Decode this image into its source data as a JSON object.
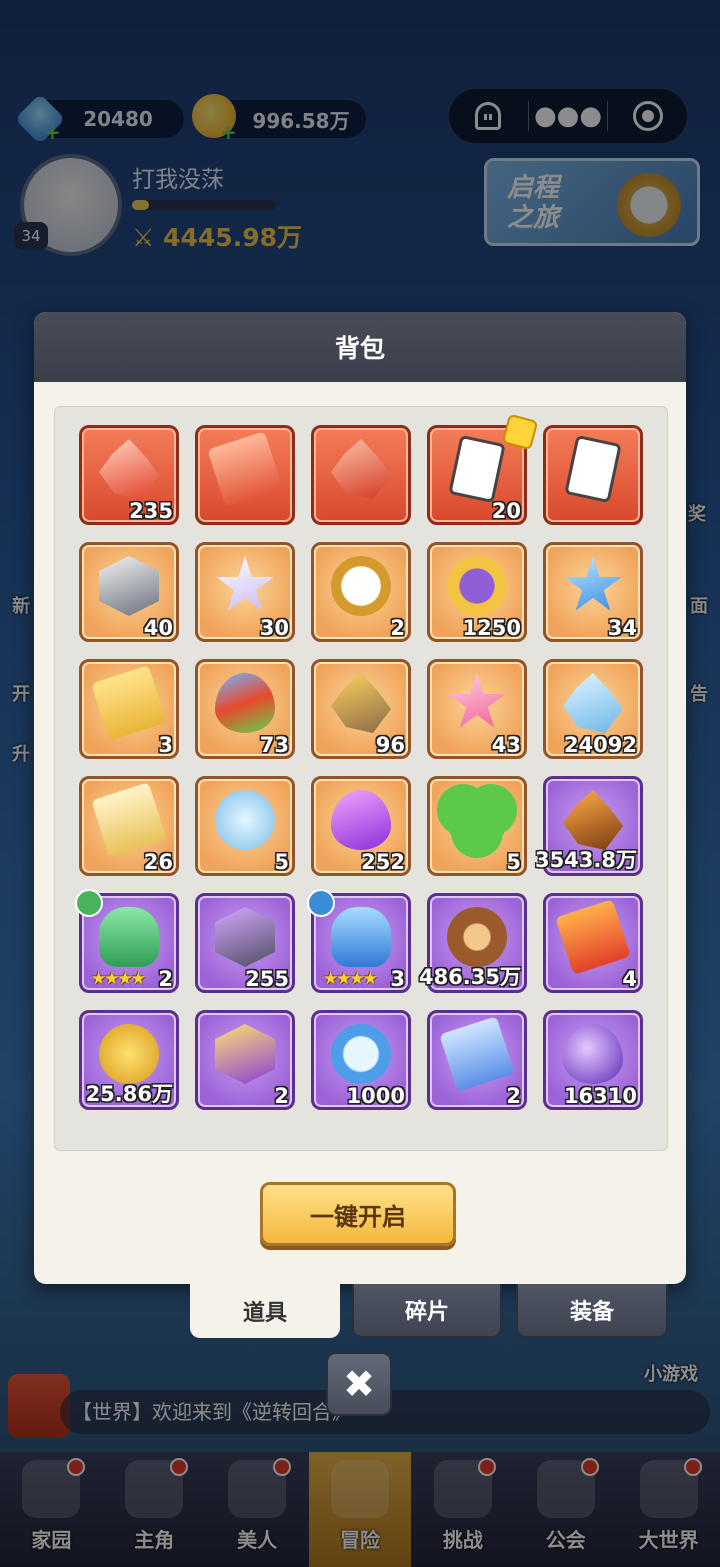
{
  "resources": {
    "gems": "20480",
    "coins": "996.58万"
  },
  "player": {
    "name": "打我没莯",
    "level": "34",
    "power": "4445.98万"
  },
  "journey_banner": {
    "line1": "启程",
    "line2": "之旅"
  },
  "side_texts": {
    "reward": "奖",
    "new": "新",
    "open": "开",
    "notice": "告",
    "face": "面",
    "upgrade": "升"
  },
  "chat": {
    "text": "【世界】欢迎来到《逆转回合》"
  },
  "mini_game": "小游戏",
  "modal": {
    "title": "背包",
    "confirm_label": "一键开启",
    "items": [
      {
        "count": "235",
        "rarity": "red",
        "icon": "red-crystal-icon"
      },
      {
        "count": "",
        "rarity": "red",
        "icon": "m-ticket-icon"
      },
      {
        "count": "",
        "rarity": "red",
        "icon": "crystal-chest-icon"
      },
      {
        "count": "20",
        "rarity": "red",
        "icon": "card-fragment-icon"
      },
      {
        "count": "",
        "rarity": "red",
        "icon": "card-icon"
      },
      {
        "count": "40",
        "rarity": "orange",
        "icon": "chest-cube-icon"
      },
      {
        "count": "30",
        "rarity": "orange",
        "icon": "star-icon"
      },
      {
        "count": "2",
        "rarity": "orange",
        "icon": "pocket-watch-icon"
      },
      {
        "count": "1250",
        "rarity": "orange",
        "icon": "compass-coin-icon"
      },
      {
        "count": "34",
        "rarity": "orange",
        "icon": "blue-star-icon"
      },
      {
        "count": "3",
        "rarity": "orange",
        "icon": "summon-ticket-icon"
      },
      {
        "count": "73",
        "rarity": "orange",
        "icon": "flame-orb-icon"
      },
      {
        "count": "96",
        "rarity": "orange",
        "icon": "gold-ore-icon"
      },
      {
        "count": "43",
        "rarity": "orange",
        "icon": "pink-star-icon"
      },
      {
        "count": "24092",
        "rarity": "orange",
        "icon": "ice-crystal-icon"
      },
      {
        "count": "26",
        "rarity": "orange",
        "icon": "winged-ticket-icon"
      },
      {
        "count": "5",
        "rarity": "orange",
        "icon": "wind-orb-icon"
      },
      {
        "count": "252",
        "rarity": "orange",
        "icon": "purple-flame-icon"
      },
      {
        "count": "5",
        "rarity": "orange",
        "icon": "clover-icon"
      },
      {
        "count": "3543.8万",
        "rarity": "purple",
        "icon": "amber-stone-icon"
      },
      {
        "count": "2",
        "rarity": "purple",
        "icon": "green-helmet-icon",
        "stars": "★★★★",
        "badge": "green"
      },
      {
        "count": "255",
        "rarity": "purple",
        "icon": "purple-cube-icon"
      },
      {
        "count": "3",
        "rarity": "purple",
        "icon": "blue-helmet-icon",
        "stars": "★★★★",
        "badge": "blue"
      },
      {
        "count": "486.35万",
        "rarity": "purple",
        "icon": "wood-logs-icon"
      },
      {
        "count": "4",
        "rarity": "purple",
        "icon": "red-ticket-icon"
      },
      {
        "count": "25.86万",
        "rarity": "purple",
        "icon": "m-coin-icon"
      },
      {
        "count": "2",
        "rarity": "purple",
        "icon": "exp-box-icon"
      },
      {
        "count": "1000",
        "rarity": "purple",
        "icon": "blue-coin-icon"
      },
      {
        "count": "2",
        "rarity": "purple",
        "icon": "blue-summon-ticket-icon"
      },
      {
        "count": "16310",
        "rarity": "purple",
        "icon": "dark-orb-icon"
      }
    ]
  },
  "tabs": {
    "items": "道具",
    "fragments": "碎片",
    "equipment": "装备"
  },
  "nav": [
    {
      "label": "家园"
    },
    {
      "label": "主角"
    },
    {
      "label": "美人"
    },
    {
      "label": "冒险"
    },
    {
      "label": "挑战"
    },
    {
      "label": "公会"
    },
    {
      "label": "大世界"
    }
  ],
  "colors": {
    "red_cell": "#e55a3a",
    "orange_cell": "#f4b774",
    "purple_cell": "#b07ae4",
    "header": "#42464f",
    "confirm": "#f7c756"
  }
}
